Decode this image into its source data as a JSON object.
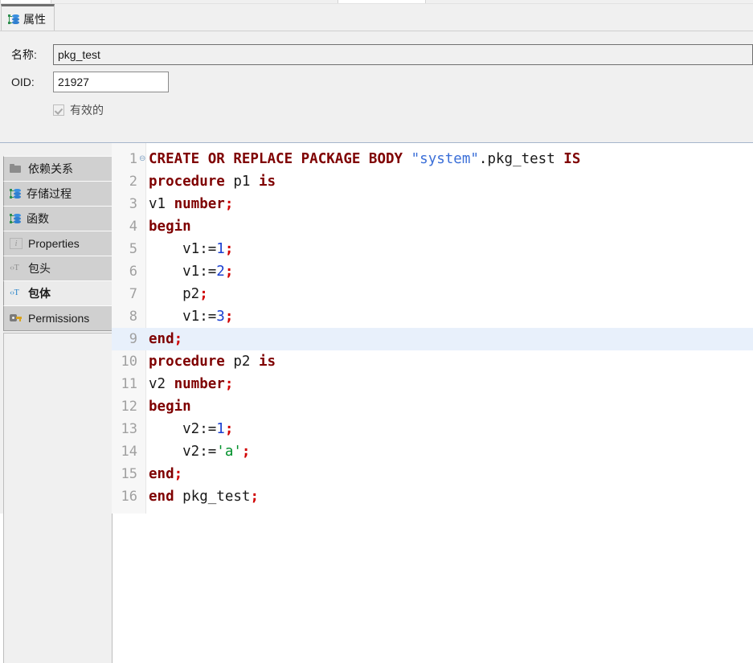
{
  "window": {
    "title_tab": "属性",
    "tab_icon": "database-tree-icon"
  },
  "form": {
    "name_label": "名称:",
    "name_value": "pkg_test",
    "name_placeholder": "",
    "oid_label": "OID:",
    "oid_value": "21927",
    "oid_placeholder": "",
    "valid_checkbox_label": "有效的",
    "valid_checked": true,
    "valid_enabled": false
  },
  "sidebar": {
    "items": [
      {
        "label": "依赖关系",
        "icon": "folder-icon",
        "selected": false
      },
      {
        "label": "存储过程",
        "icon": "database-tree-icon",
        "selected": false
      },
      {
        "label": "函数",
        "icon": "database-tree-icon",
        "selected": false
      },
      {
        "label": "Properties",
        "icon": "info-icon",
        "selected": false
      },
      {
        "label": "包头",
        "icon": "code-text-icon",
        "selected": false
      },
      {
        "label": "包体",
        "icon": "code-text-icon",
        "selected": true
      },
      {
        "label": "Permissions",
        "icon": "key-icon",
        "selected": false
      }
    ]
  },
  "editor": {
    "current_line": 9,
    "colors": {
      "keyword": "#7f0000",
      "number": "#1a3fd0",
      "punctuation": "#d00000",
      "string_quoted_ident": "#3b6fd8",
      "string_literal": "#00902a",
      "plain": "#1a1a1a",
      "line_number": "#a0a0a0",
      "current_line_bg": "#e8f0fb",
      "gutter_bg": "#f7f7f7",
      "editor_bg": "#ffffff"
    },
    "lines": [
      {
        "n": 1,
        "fold": "⊖",
        "tokens": [
          {
            "t": "CREATE OR REPLACE PACKAGE BODY ",
            "c": "kw"
          },
          {
            "t": "\"system\"",
            "c": "str"
          },
          {
            "t": ".pkg_test ",
            "c": "pln"
          },
          {
            "t": "IS",
            "c": "kw"
          }
        ]
      },
      {
        "n": 2,
        "fold": "",
        "tokens": [
          {
            "t": "procedure ",
            "c": "kw"
          },
          {
            "t": "p1 ",
            "c": "pln"
          },
          {
            "t": "is",
            "c": "kw"
          }
        ]
      },
      {
        "n": 3,
        "fold": "",
        "tokens": [
          {
            "t": "v1 ",
            "c": "pln"
          },
          {
            "t": "number",
            "c": "kw"
          },
          {
            "t": ";",
            "c": "pun"
          }
        ]
      },
      {
        "n": 4,
        "fold": "",
        "tokens": [
          {
            "t": "begin",
            "c": "kw"
          }
        ]
      },
      {
        "n": 5,
        "fold": "",
        "tokens": [
          {
            "t": "    v1:=",
            "c": "pln"
          },
          {
            "t": "1",
            "c": "num"
          },
          {
            "t": ";",
            "c": "pun"
          }
        ]
      },
      {
        "n": 6,
        "fold": "",
        "tokens": [
          {
            "t": "    v1:=",
            "c": "pln"
          },
          {
            "t": "2",
            "c": "num"
          },
          {
            "t": ";",
            "c": "pun"
          }
        ]
      },
      {
        "n": 7,
        "fold": "",
        "tokens": [
          {
            "t": "    p2",
            "c": "pln"
          },
          {
            "t": ";",
            "c": "pun"
          }
        ]
      },
      {
        "n": 8,
        "fold": "",
        "tokens": [
          {
            "t": "    v1:=",
            "c": "pln"
          },
          {
            "t": "3",
            "c": "num"
          },
          {
            "t": ";",
            "c": "pun"
          }
        ]
      },
      {
        "n": 9,
        "fold": "",
        "tokens": [
          {
            "t": "end",
            "c": "kw"
          },
          {
            "t": ";",
            "c": "pun"
          }
        ]
      },
      {
        "n": 10,
        "fold": "",
        "tokens": [
          {
            "t": "procedure ",
            "c": "kw"
          },
          {
            "t": "p2 ",
            "c": "pln"
          },
          {
            "t": "is",
            "c": "kw"
          }
        ]
      },
      {
        "n": 11,
        "fold": "",
        "tokens": [
          {
            "t": "v2 ",
            "c": "pln"
          },
          {
            "t": "number",
            "c": "kw"
          },
          {
            "t": ";",
            "c": "pun"
          }
        ]
      },
      {
        "n": 12,
        "fold": "",
        "tokens": [
          {
            "t": "begin",
            "c": "kw"
          }
        ]
      },
      {
        "n": 13,
        "fold": "",
        "tokens": [
          {
            "t": "    v2:=",
            "c": "pln"
          },
          {
            "t": "1",
            "c": "num"
          },
          {
            "t": ";",
            "c": "pun"
          }
        ]
      },
      {
        "n": 14,
        "fold": "",
        "tokens": [
          {
            "t": "    v2:=",
            "c": "pln"
          },
          {
            "t": "'a'",
            "c": "strq"
          },
          {
            "t": ";",
            "c": "pun"
          }
        ]
      },
      {
        "n": 15,
        "fold": "",
        "tokens": [
          {
            "t": "end",
            "c": "kw"
          },
          {
            "t": ";",
            "c": "pun"
          }
        ]
      },
      {
        "n": 16,
        "fold": "",
        "tokens": [
          {
            "t": "end ",
            "c": "kw"
          },
          {
            "t": "pkg_test",
            "c": "pln"
          },
          {
            "t": ";",
            "c": "pun"
          }
        ]
      }
    ]
  }
}
